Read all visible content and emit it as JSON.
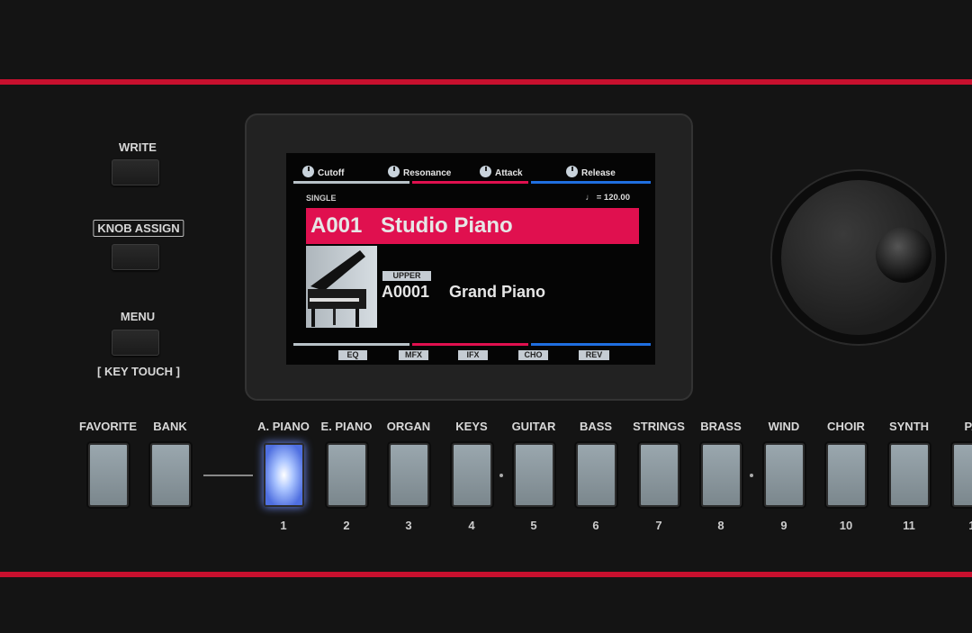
{
  "colors": {
    "accent_red": "#c8102e",
    "screen_red": "#e0104f",
    "screen_blue": "#1f6fe0",
    "active_pad": "#6f8fff"
  },
  "left_buttons": [
    {
      "label": "WRITE"
    },
    {
      "label": "KNOB ASSIGN"
    },
    {
      "label": "MENU",
      "sub_label": "[ KEY TOUCH ]"
    }
  ],
  "screen": {
    "knobs": [
      "Cutoff",
      "Resonance",
      "Attack",
      "Release"
    ],
    "mode": "SINGLE",
    "tempo": "♩ = 120.00",
    "program_number": "A001",
    "program_name": "Studio Piano",
    "part_badge": "UPPER",
    "tone_number": "A0001",
    "tone_name": "Grand Piano",
    "tabs": [
      "EQ",
      "MFX",
      "IFX",
      "CHO",
      "REV"
    ]
  },
  "pads": [
    {
      "label": "FAVORITE",
      "number": ""
    },
    {
      "label": "BANK",
      "number": ""
    },
    {
      "label": "A. PIANO",
      "number": "1",
      "active": true
    },
    {
      "label": "E. PIANO",
      "number": "2"
    },
    {
      "label": "ORGAN",
      "number": "3"
    },
    {
      "label": "KEYS",
      "number": "4"
    },
    {
      "label": "GUITAR",
      "number": "5"
    },
    {
      "label": "BASS",
      "number": "6"
    },
    {
      "label": "STRINGS",
      "number": "7"
    },
    {
      "label": "BRASS",
      "number": "8"
    },
    {
      "label": "WIND",
      "number": "9"
    },
    {
      "label": "CHOIR",
      "number": "10"
    },
    {
      "label": "SYNTH",
      "number": "11"
    },
    {
      "label": "PA",
      "number": "1"
    }
  ]
}
